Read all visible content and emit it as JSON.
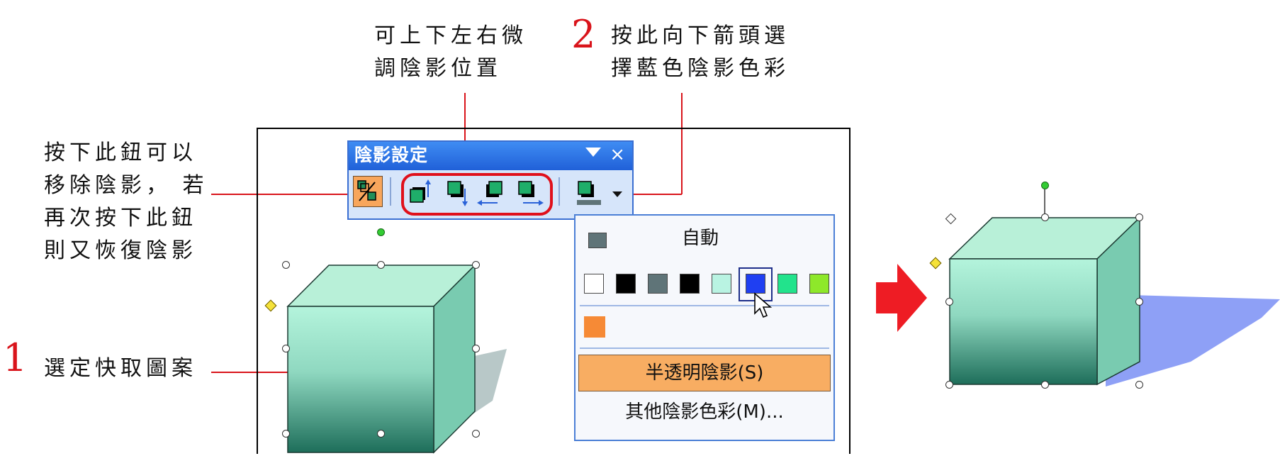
{
  "annotations": {
    "remove_shadow": [
      "按下此鈕可以",
      "移除陰影， 若",
      "再次按下此鈕",
      "則又恢復陰影"
    ],
    "nudge": [
      "可上下左右微",
      "調陰影位置"
    ],
    "step1_number": "1",
    "step1_text": "選定快取圖案",
    "step2_number": "2",
    "step2_text": [
      "按此向下箭頭選",
      "擇藍色陰影色彩"
    ]
  },
  "toolbar": {
    "title": "陰影設定",
    "close_symbol": "×",
    "buttons": [
      "shadow-on-off-icon",
      "nudge-shadow-up-icon",
      "nudge-shadow-down-icon",
      "nudge-shadow-left-icon",
      "nudge-shadow-right-icon",
      "shadow-color-icon"
    ]
  },
  "shadow_color_menu": {
    "automatic_label": "自動",
    "automatic_color": "#5f7478",
    "palette": [
      "#ffffff",
      "#000000",
      "#5f7478",
      "#000000",
      "#b9f3e2",
      "#1f3ff2",
      "#22e38c",
      "#8ee82a"
    ],
    "selected_index": 5,
    "recent_color": "#f68a36",
    "translucent_option": "半透明陰影(S)",
    "more_colors_option": "其他陰影色彩(M)..."
  },
  "colors": {
    "callout_line": "#d9141b",
    "number": "#d9141b",
    "arrow": "#ee1c24",
    "cube_front_top": "#b4f4dc",
    "cube_front_bottom": "#1e6e5a",
    "cube_top": "#b8f0d8",
    "cube_side": "#79cbb0",
    "shadow_gray": "#b8c8c8",
    "shadow_blue": "#8ea0f6"
  }
}
